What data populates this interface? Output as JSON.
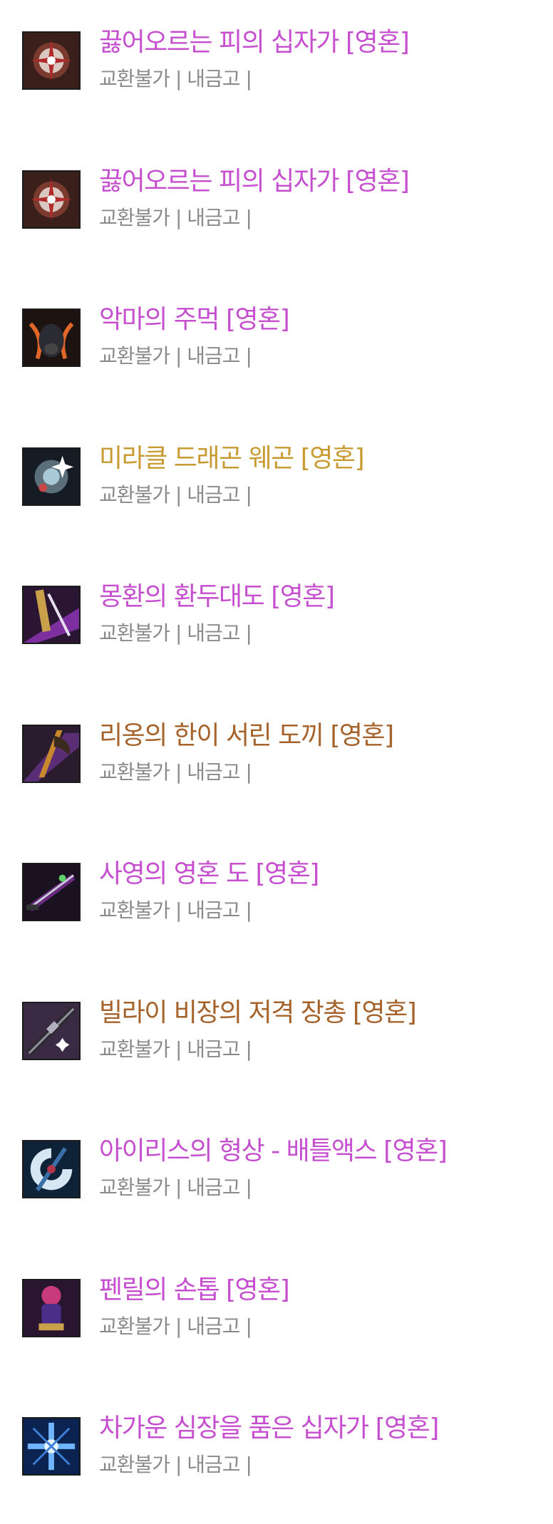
{
  "items": [
    {
      "name": "끓어오르는 피의 십자가 [영혼]",
      "meta": "교환불가 | 내금고 |",
      "color": "pink",
      "icon": "blood-cross-icon"
    },
    {
      "name": "끓어오르는 피의 십자가 [영혼]",
      "meta": "교환불가 | 내금고 |",
      "color": "pink",
      "icon": "blood-cross-icon"
    },
    {
      "name": "악마의 주먹 [영혼]",
      "meta": "교환불가 | 내금고 |",
      "color": "pink",
      "icon": "demon-fist-icon"
    },
    {
      "name": "미라클 드래곤 웨곤 [영혼]",
      "meta": "교환불가 | 내금고 |",
      "color": "gold",
      "icon": "dragon-wagon-icon"
    },
    {
      "name": "몽환의 환두대도 [영혼]",
      "meta": "교환불가 | 내금고 |",
      "color": "pink",
      "icon": "dream-sword-icon"
    },
    {
      "name": "리옹의 한이 서린 도끼 [영혼]",
      "meta": "교환불가 | 내금고 |",
      "color": "brown",
      "icon": "axe-icon"
    },
    {
      "name": "사영의 영혼 도 [영혼]",
      "meta": "교환불가 | 내금고 |",
      "color": "pink",
      "icon": "soul-blade-icon"
    },
    {
      "name": "빌라이 비장의 저격 장총 [영혼]",
      "meta": "교환불가 | 내금고 |",
      "color": "brown",
      "icon": "sniper-rifle-icon"
    },
    {
      "name": "아이리스의 형상 - 배틀액스 [영혼]",
      "meta": "교환불가 | 내금고 |",
      "color": "pink",
      "icon": "battle-axe-icon"
    },
    {
      "name": "펜릴의 손톱 [영혼]",
      "meta": "교환불가 | 내금고 |",
      "color": "pink",
      "icon": "fenrir-claw-icon"
    },
    {
      "name": "차가운 심장을 품은 십자가 [영혼]",
      "meta": "교환불가 | 내금고 |",
      "color": "pink",
      "icon": "ice-cross-icon"
    }
  ],
  "colors": {
    "pink": "#c54fcf",
    "gold": "#c79b32",
    "brown": "#a5622a",
    "meta": "#8a8a8a"
  }
}
